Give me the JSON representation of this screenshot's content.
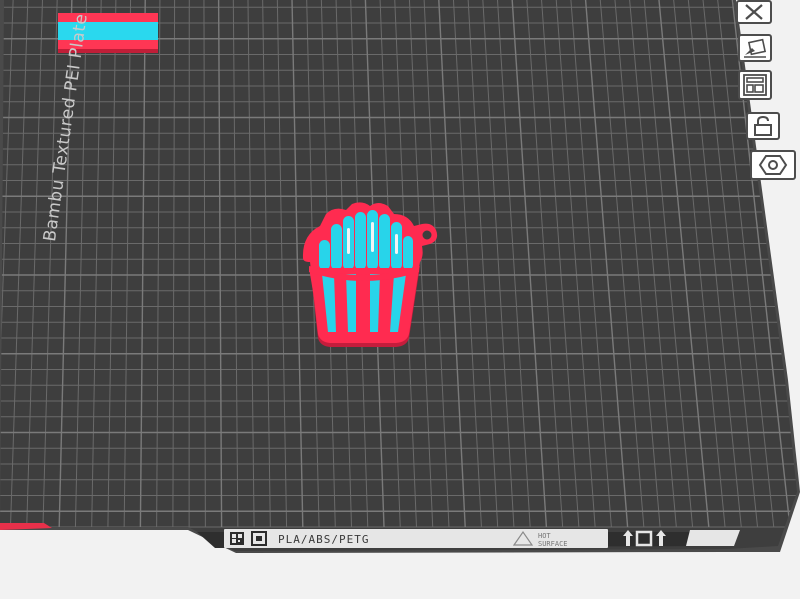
{
  "plate": {
    "label": "Bambu Textured PEI Plate",
    "material_text": "PLA/ABS/PETG",
    "warning_text_line1": "HOT",
    "warning_text_line2": "SURFACE"
  },
  "colors": {
    "background": "#f2f2f2",
    "bed_frame": "#4a4a4a",
    "bed_surface": "#3e3e3e",
    "grid_line": "#6b6b6b",
    "model_red": "#ff2b50",
    "model_cyan": "#28d4ea",
    "model_white": "#f2f4f4"
  },
  "toolbar": {
    "buttons": [
      {
        "name": "close-view-button",
        "icon": "x-icon"
      },
      {
        "name": "edit-plate-button",
        "icon": "edit-plate-icon"
      },
      {
        "name": "arrange-button",
        "icon": "arrange-icon"
      },
      {
        "name": "lock-plate-button",
        "icon": "lock-icon"
      },
      {
        "name": "plate-settings-button",
        "icon": "hexagon-settings-icon"
      }
    ]
  }
}
